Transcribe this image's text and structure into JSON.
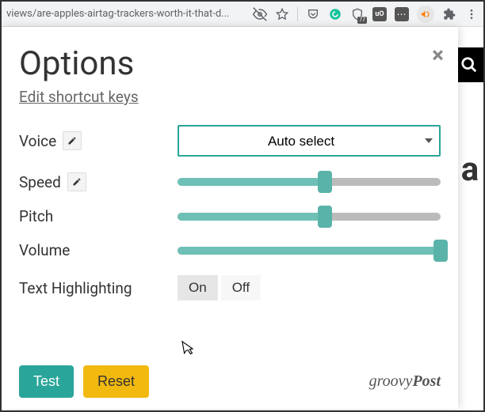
{
  "chrome": {
    "url_fragment": "views/are-apples-airtag-trackers-worth-it-that-d...",
    "icons": {
      "eye": "eye-off-icon",
      "star": "star-icon",
      "pocket": "pocket-icon",
      "grammarly": "grammarly-icon",
      "shield": "shield-icon",
      "ublock": "ublock-icon",
      "dots": "menu-dots-icon",
      "megaphone": "megaphone-icon",
      "puzzle": "extensions-icon",
      "kebab": "browser-menu-icon"
    }
  },
  "right": {
    "search_name": "search-icon",
    "preview_letter": "a"
  },
  "panel": {
    "title": "Options",
    "edit_link": "Edit shortcut keys",
    "rows": {
      "voice": {
        "label": "Voice",
        "value": "Auto select"
      },
      "speed": {
        "label": "Speed",
        "percent": 56
      },
      "pitch": {
        "label": "Pitch",
        "percent": 56
      },
      "volume": {
        "label": "Volume",
        "percent": 100
      },
      "highlight": {
        "label": "Text Highlighting",
        "on": "On",
        "off": "Off",
        "active": "On"
      }
    },
    "buttons": {
      "test": "Test",
      "reset": "Reset"
    },
    "brand_prefix": "groovy",
    "brand_suffix": "Post"
  }
}
